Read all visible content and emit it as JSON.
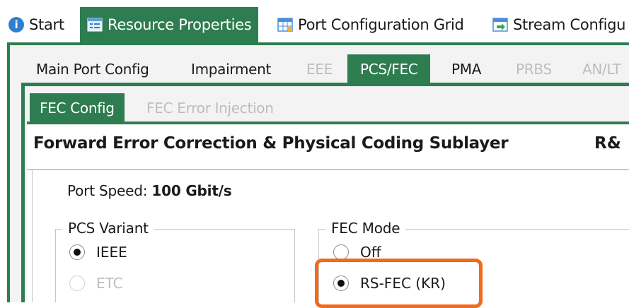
{
  "top_tabs": [
    {
      "label": "Start",
      "icon": "info-icon"
    },
    {
      "label": "Resource Properties",
      "icon": "properties-icon"
    },
    {
      "label": "Port Configuration Grid",
      "icon": "grid-icon"
    },
    {
      "label": "Stream Configu",
      "icon": "stream-icon"
    }
  ],
  "sub_tabs": [
    {
      "label": "Main Port Config"
    },
    {
      "label": "Impairment"
    },
    {
      "label": "EEE"
    },
    {
      "label": "PCS/FEC"
    },
    {
      "label": "PMA"
    },
    {
      "label": "PRBS"
    },
    {
      "label": "AN/LT"
    }
  ],
  "fec_tabs": [
    {
      "label": "FEC Config"
    },
    {
      "label": "FEC Error Injection"
    }
  ],
  "panel": {
    "heading": "Forward Error Correction & Physical Coding Sublayer",
    "heading_right": "R&",
    "port_speed_label": "Port Speed:",
    "port_speed_value": "100 Gbit/s"
  },
  "pcs_variant": {
    "title": "PCS Variant",
    "options": [
      {
        "label": "IEEE",
        "selected": true,
        "disabled": false
      },
      {
        "label": "ETC",
        "selected": false,
        "disabled": true
      }
    ]
  },
  "fec_mode": {
    "title": "FEC Mode",
    "options": [
      {
        "label": "Off",
        "selected": false,
        "disabled": false
      },
      {
        "label": "RS-FEC (KR)",
        "selected": true,
        "disabled": false
      }
    ]
  },
  "colors": {
    "accent_green": "#2e7d50",
    "highlight_orange": "#f26a1b",
    "disabled_text": "#bdbdbd"
  }
}
